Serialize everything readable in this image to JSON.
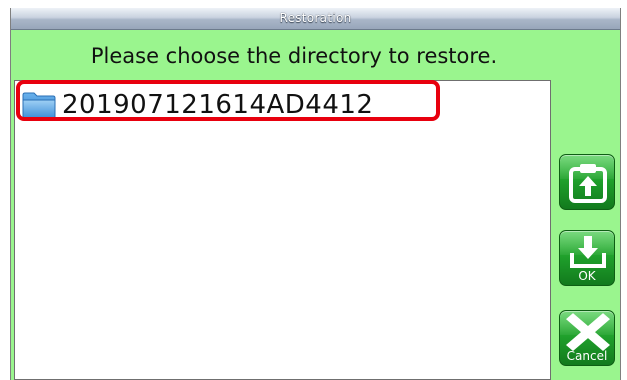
{
  "window": {
    "title": "Restoration"
  },
  "prompt": {
    "text": "Please choose the directory to restore."
  },
  "directory_list": {
    "items": [
      {
        "name": "201907121614AD4412",
        "icon": "folder-icon"
      }
    ],
    "selected_highlight_color": "#e8000e"
  },
  "buttons": {
    "restore": {
      "icon": "restore-clipboard-icon",
      "label": ""
    },
    "ok": {
      "icon": "download-icon",
      "label": "OK"
    },
    "cancel": {
      "icon": "cancel-x-icon",
      "label": "Cancel"
    }
  },
  "colors": {
    "panel_background": "#9af58e",
    "button_green": "#1d9a29"
  }
}
